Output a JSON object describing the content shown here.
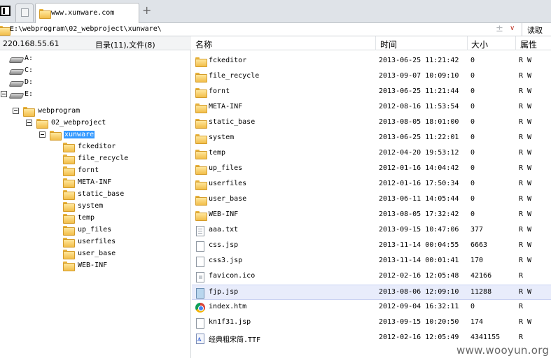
{
  "tabs": {
    "active_url": "www.xunware.com",
    "new_tab_glyph": "+"
  },
  "address": {
    "path": "E:\\webprogram\\02_webproject\\xunware\\",
    "read_label": "读取",
    "plus_glyph": "±",
    "drop_glyph": "∨"
  },
  "left": {
    "ip": "220.168.55.61",
    "counts": "目录(11),文件(8)",
    "tree": [
      {
        "label": "A:",
        "type": "drive",
        "depth": 0
      },
      {
        "label": "C:",
        "type": "drive",
        "depth": 0
      },
      {
        "label": "D:",
        "type": "drive",
        "depth": 0
      },
      {
        "label": "E:",
        "type": "drive",
        "depth": 0,
        "expanded": true
      },
      {
        "label": "webprogram",
        "type": "folder",
        "depth": 1,
        "expanded": true
      },
      {
        "label": "02_webproject",
        "type": "folder",
        "depth": 2,
        "expanded": true
      },
      {
        "label": "xunware",
        "type": "folder",
        "depth": 3,
        "expanded": true,
        "selected": true
      },
      {
        "label": "fckeditor",
        "type": "folder",
        "depth": 4
      },
      {
        "label": "file_recycle",
        "type": "folder",
        "depth": 4
      },
      {
        "label": "fornt",
        "type": "folder",
        "depth": 4
      },
      {
        "label": "META-INF",
        "type": "folder",
        "depth": 4
      },
      {
        "label": "static_base",
        "type": "folder",
        "depth": 4
      },
      {
        "label": "system",
        "type": "folder",
        "depth": 4
      },
      {
        "label": "temp",
        "type": "folder",
        "depth": 4
      },
      {
        "label": "up_files",
        "type": "folder",
        "depth": 4
      },
      {
        "label": "userfiles",
        "type": "folder",
        "depth": 4
      },
      {
        "label": "user_base",
        "type": "folder",
        "depth": 4
      },
      {
        "label": "WEB-INF",
        "type": "folder",
        "depth": 4
      }
    ]
  },
  "list": {
    "headers": {
      "name": "名称",
      "time": "时间",
      "size": "大小",
      "attr": "属性"
    },
    "rows": [
      {
        "icon": "folder",
        "name": "fckeditor",
        "time": "2013-06-25 11:21:42",
        "size": "0",
        "attr": "R W"
      },
      {
        "icon": "folder",
        "name": "file_recycle",
        "time": "2013-09-07 10:09:10",
        "size": "0",
        "attr": "R W"
      },
      {
        "icon": "folder",
        "name": "fornt",
        "time": "2013-06-25 11:21:44",
        "size": "0",
        "attr": "R W"
      },
      {
        "icon": "folder",
        "name": "META-INF",
        "time": "2012-08-16 11:53:54",
        "size": "0",
        "attr": "R W"
      },
      {
        "icon": "folder",
        "name": "static_base",
        "time": "2013-08-05 18:01:00",
        "size": "0",
        "attr": "R W"
      },
      {
        "icon": "folder",
        "name": "system",
        "time": "2013-06-25 11:22:01",
        "size": "0",
        "attr": "R W"
      },
      {
        "icon": "folder",
        "name": "temp",
        "time": "2012-04-20 19:53:12",
        "size": "0",
        "attr": "R W"
      },
      {
        "icon": "folder",
        "name": "up_files",
        "time": "2012-01-16 14:04:42",
        "size": "0",
        "attr": "R W"
      },
      {
        "icon": "folder",
        "name": "userfiles",
        "time": "2012-01-16 17:50:34",
        "size": "0",
        "attr": "R W"
      },
      {
        "icon": "folder",
        "name": "user_base",
        "time": "2013-06-11 14:05:44",
        "size": "0",
        "attr": "R W"
      },
      {
        "icon": "folder",
        "name": "WEB-INF",
        "time": "2013-08-05 17:32:42",
        "size": "0",
        "attr": "R W"
      },
      {
        "icon": "txt",
        "name": "aaa.txt",
        "time": "2013-09-15 10:47:06",
        "size": "377",
        "attr": "R W"
      },
      {
        "icon": "doc",
        "name": "css.jsp",
        "time": "2013-11-14 00:04:55",
        "size": "6663",
        "attr": "R W"
      },
      {
        "icon": "doc",
        "name": "css3.jsp",
        "time": "2013-11-14 00:01:41",
        "size": "170",
        "attr": "R W"
      },
      {
        "icon": "ico",
        "name": "favicon.ico",
        "time": "2012-02-16 12:05:48",
        "size": "42166",
        "attr": "R"
      },
      {
        "icon": "jsp-sel",
        "name": "fjp.jsp",
        "time": "2013-08-06 12:09:10",
        "size": "11288",
        "attr": "R W",
        "selected": true
      },
      {
        "icon": "chrome",
        "name": "index.htm",
        "time": "2012-09-04 16:32:11",
        "size": "0",
        "attr": "R"
      },
      {
        "icon": "doc",
        "name": "kn1f31.jsp",
        "time": "2013-09-15 10:20:50",
        "size": "174",
        "attr": "R W"
      },
      {
        "icon": "font",
        "name": "经典粗宋简.TTF",
        "time": "2012-02-16 12:05:49",
        "size": "4341155",
        "attr": "R"
      }
    ]
  },
  "watermark": "www.wooyun.org"
}
